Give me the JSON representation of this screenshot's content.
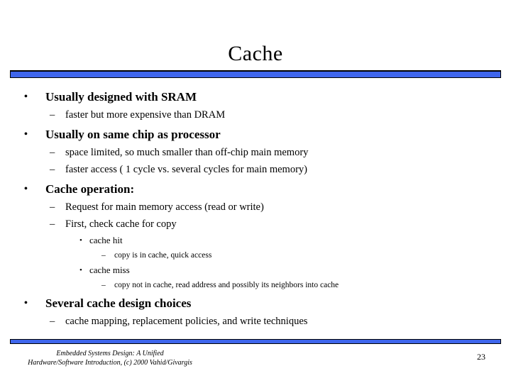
{
  "slide": {
    "title": "Cache",
    "page_number": "23",
    "accent_color": "#3f66ec",
    "text_color": "#000000",
    "background_color": "#ffffff"
  },
  "bullets": [
    {
      "level": 1,
      "marker": "•",
      "text": "Usually designed with SRAM"
    },
    {
      "level": 2,
      "marker": "–",
      "text": "faster but more expensive than DRAM"
    },
    {
      "level": 1,
      "marker": "•",
      "text": "Usually on same chip as processor"
    },
    {
      "level": 2,
      "marker": "–",
      "text": "space limited, so much smaller than off-chip main memory"
    },
    {
      "level": 2,
      "marker": "–",
      "text": "faster access ( 1 cycle vs. several cycles for main memory)"
    },
    {
      "level": 1,
      "marker": "•",
      "text": "Cache operation:"
    },
    {
      "level": 2,
      "marker": "–",
      "text": "Request for main memory access (read or write)"
    },
    {
      "level": 2,
      "marker": "–",
      "text": "First, check cache for copy"
    },
    {
      "level": 3,
      "marker": "•",
      "text": "cache hit"
    },
    {
      "level": 4,
      "marker": "–",
      "text": "copy is in cache, quick access"
    },
    {
      "level": 3,
      "marker": "•",
      "text": "cache miss"
    },
    {
      "level": 4,
      "marker": "–",
      "text": "copy not in cache, read address and possibly its neighbors into cache"
    },
    {
      "level": 1,
      "marker": "•",
      "text": "Several cache design choices"
    },
    {
      "level": 2,
      "marker": "–",
      "text": "cache mapping, replacement policies, and write techniques"
    }
  ],
  "footer": {
    "line1": "Embedded Systems Design: A Unified",
    "line2": "Hardware/Software Introduction, (c) 2000 Vahid/Givargis"
  }
}
